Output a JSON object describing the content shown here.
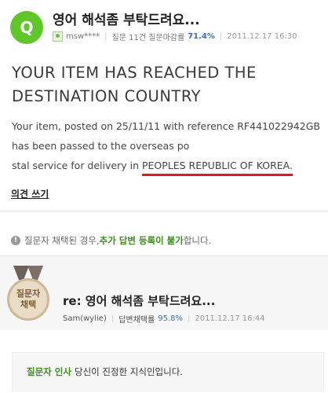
{
  "question": {
    "badge": "Q",
    "title": "영어 해석좀 부탁드려요...",
    "user": "msw****",
    "stat_label": "질문 11건 질문마감률",
    "stat_value": "71.4%",
    "date": "2011.12.17 16:30"
  },
  "content": {
    "headline_line1": "YOUR ITEM HAS REACHED THE",
    "headline_line2": "DESTINATION COUNTRY",
    "body_line1": "Your item, posted on 25/11/11 with reference RF441022942GB",
    "body_line2": "has been passed to the overseas po",
    "body_line3_prefix": "stal service for delivery in ",
    "body_line3_highlight": "PEOPLES REPUBLIC OF KOREA.",
    "highlight_color": "#d61c1c"
  },
  "actions": {
    "opinion_link": "의견 쓰기"
  },
  "notice": {
    "prefix": "질문자 채택된 경우, ",
    "emphasis": "추가 답변 등록이 불가",
    "suffix": "합니다."
  },
  "answer": {
    "medal_line1": "질문자",
    "medal_line2": "채택",
    "title": "re: 영어 해석좀 부탁드려요...",
    "user": "Sam(wylie)",
    "rate_label": "답변채택률",
    "rate_value": "95.8%",
    "date": "2011.12.17 16:44"
  },
  "thanks": {
    "label": "질문자 인사",
    "text": "당신이 진정한 지식인입니다."
  },
  "colors": {
    "badge_green": "#5fc72a",
    "accent_green": "#3b8f1f",
    "accent_blue": "#3b70b8"
  }
}
